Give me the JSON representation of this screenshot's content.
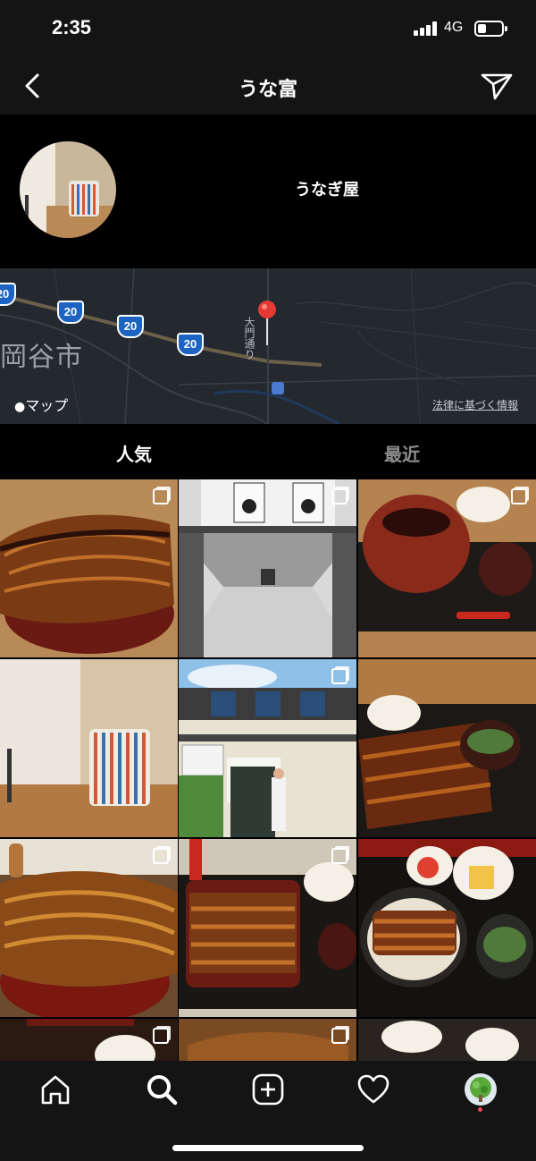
{
  "status_bar": {
    "time": "2:35",
    "network": "4G"
  },
  "nav": {
    "title": "うな富",
    "back_icon": "chevron-left-icon",
    "send_icon": "paper-plane-icon"
  },
  "profile": {
    "category": "うなぎ屋"
  },
  "map": {
    "city": "岡谷市",
    "road_label": "大門通り",
    "route_number": "20",
    "brand": "マップ",
    "legal": "法律に基づく情報"
  },
  "tabs": {
    "popular": "人気",
    "recent": "最近"
  },
  "grid": {
    "tiles": [
      "eel-rice-bowl",
      "shrine-gate-bw",
      "lidded-bowl-set",
      "tea-cup",
      "shop-front",
      "eel-set-meal",
      "grilled-eel-bowl",
      "eel-jubako-set",
      "eel-don-set",
      "partial-1",
      "partial-2",
      "partial-3"
    ]
  },
  "tabbar": {
    "items": [
      "home-icon",
      "search-icon",
      "add-post-icon",
      "heart-icon",
      "profile-avatar"
    ]
  },
  "colors": {
    "background": "#000000",
    "bar": "#141414",
    "inactive": "#8e8e8e",
    "accent_red": "#ed4956",
    "map_bg": "#24282f"
  }
}
